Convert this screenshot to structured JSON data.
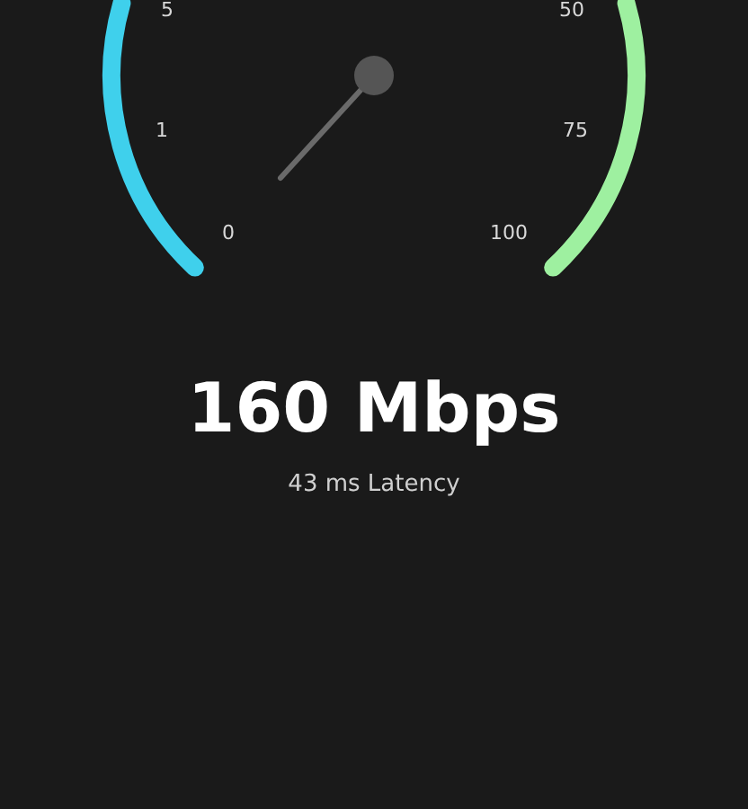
{
  "gauge": {
    "scale_labels": [
      "5",
      "1",
      "0",
      "50",
      "75",
      "100"
    ]
  },
  "speed": "160 Mbps",
  "latency": "43 ms Latency"
}
